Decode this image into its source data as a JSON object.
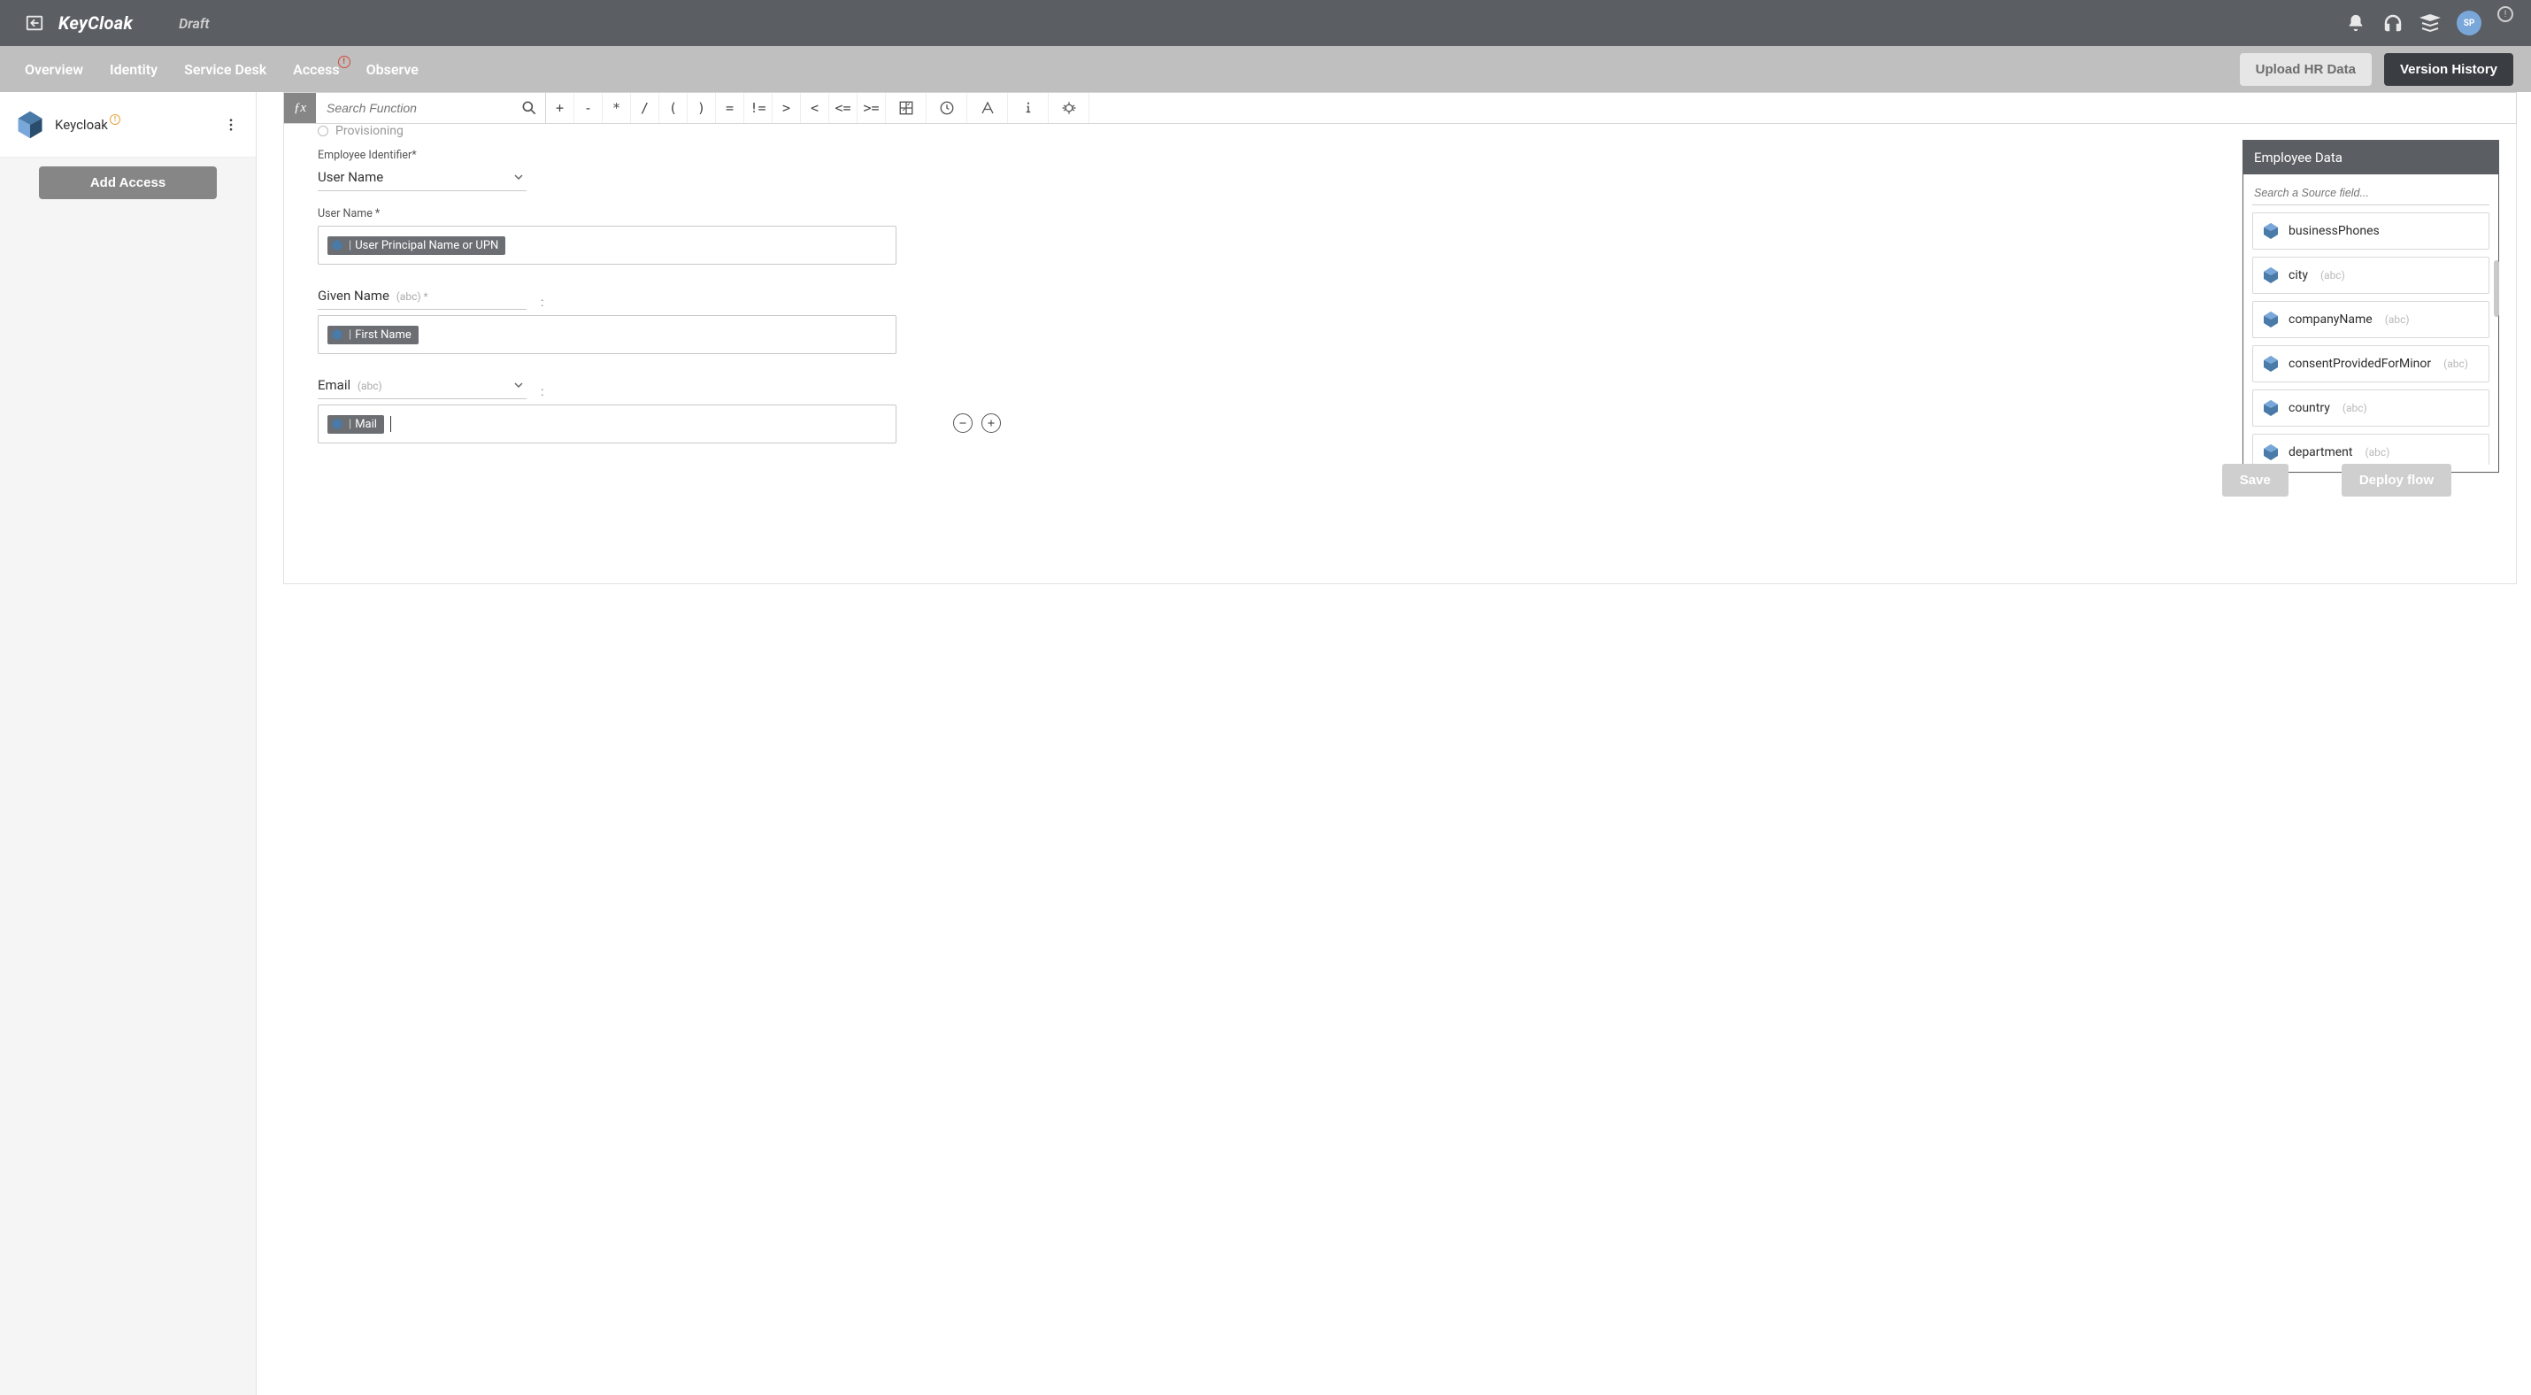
{
  "topbar": {
    "app_title": "KeyCloak",
    "draft": "Draft",
    "avatar_initials": "SP"
  },
  "tabs": {
    "items": [
      "Overview",
      "Identity",
      "Service Desk",
      "Access",
      "Observe"
    ],
    "alert_index": 3,
    "alert_glyph": "!"
  },
  "tabbar_buttons": {
    "upload": "Upload HR Data",
    "version": "Version History"
  },
  "sidebar": {
    "app_name": "Keycloak",
    "warn_glyph": "!",
    "add_access": "Add Access"
  },
  "fxbar": {
    "search_placeholder": "Search Function",
    "ops": [
      "+",
      "-",
      "*",
      "/",
      "(",
      ")",
      "=",
      "!=",
      ">",
      "<",
      "<=",
      ">="
    ]
  },
  "form": {
    "provisioning_label": "Provisioning",
    "employee_identifier_label": "Employee Identifier*",
    "employee_identifier_value": "User Name",
    "fields": [
      {
        "label": "User Name *",
        "token": "User Principal Name or UPN",
        "select": false,
        "colon": false,
        "controls": false,
        "cursor": false,
        "select_suffix": ""
      },
      {
        "label": "Given Name",
        "select_suffix": "(abc) *",
        "token": "First Name",
        "select": true,
        "colon": true,
        "controls": false,
        "cursor": false
      },
      {
        "label": "Email",
        "select_suffix": "(abc)",
        "token": "Mail",
        "select": true,
        "colon": true,
        "controls": true,
        "cursor": true
      }
    ]
  },
  "emp_panel": {
    "title": "Employee Data",
    "search_placeholder": "Search a Source field...",
    "items": [
      {
        "name": "businessPhones",
        "type": ""
      },
      {
        "name": "city",
        "type": "(abc)"
      },
      {
        "name": "companyName",
        "type": "(abc)"
      },
      {
        "name": "consentProvidedForMinor",
        "type": "(abc)"
      },
      {
        "name": "country",
        "type": "(abc)"
      },
      {
        "name": "department",
        "type": "(abc)"
      }
    ]
  },
  "actions": {
    "save": "Save",
    "deploy": "Deploy flow"
  }
}
